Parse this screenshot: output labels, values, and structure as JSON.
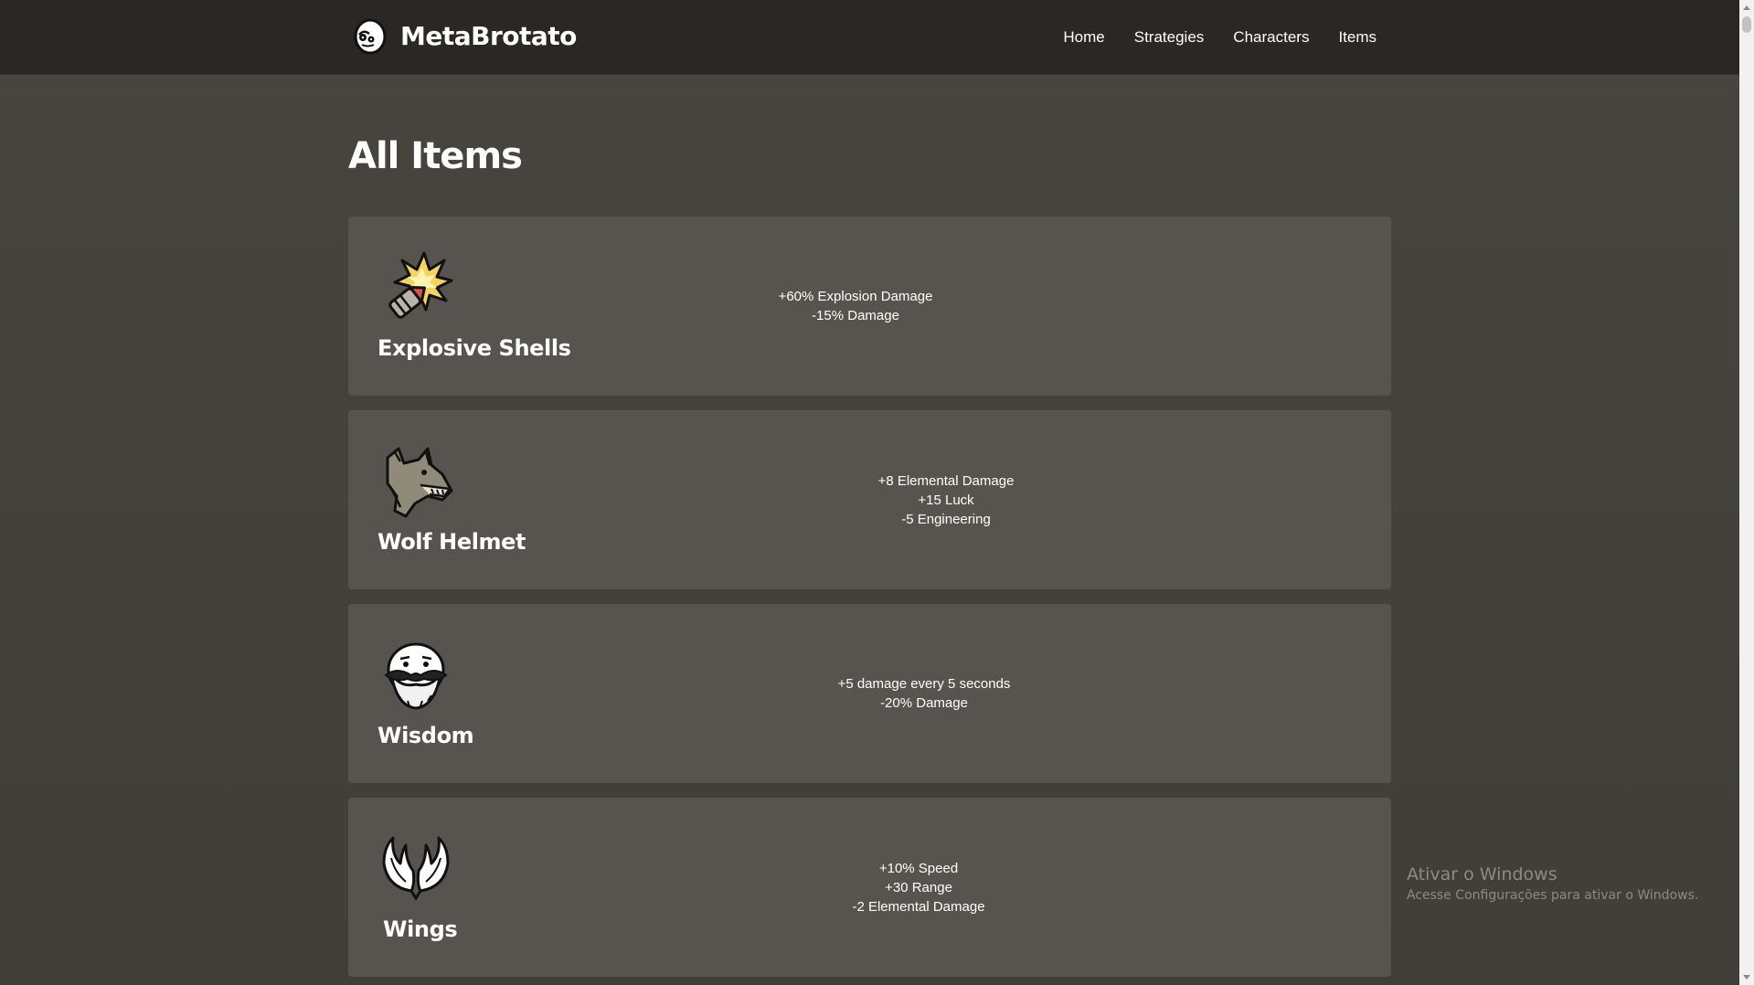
{
  "header": {
    "brand": "MetaBrotato",
    "nav": [
      "Home",
      "Strategies",
      "Characters",
      "Items"
    ]
  },
  "main": {
    "title": "All Items",
    "items": [
      {
        "name": "Explosive Shells",
        "icon": "explosive-shells-icon",
        "stats": [
          "+60% Explosion Damage",
          "-15% Damage"
        ]
      },
      {
        "name": "Wolf Helmet",
        "icon": "wolf-helmet-icon",
        "stats": [
          "+8 Elemental Damage",
          "+15 Luck",
          "-5 Engineering"
        ]
      },
      {
        "name": "Wisdom",
        "icon": "wisdom-icon",
        "stats": [
          "+5 damage every 5 seconds",
          "-20% Damage"
        ]
      },
      {
        "name": "Wings",
        "icon": "wings-icon",
        "stats": [
          "+10% Speed",
          "+30 Range",
          "-2 Elemental Damage"
        ]
      }
    ]
  },
  "watermark": {
    "title": "Ativar o Windows",
    "subtitle": "Acesse Configurações para ativar o Windows."
  },
  "colors": {
    "navbar_bg": "#2a2725",
    "page_bg": "#45423d",
    "card_bg": "#57544f",
    "text": "#ffffff"
  }
}
